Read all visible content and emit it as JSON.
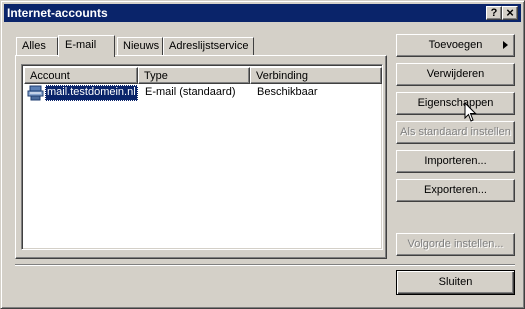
{
  "window": {
    "title": "Internet-accounts",
    "help_button": "?",
    "close_button": "×"
  },
  "tabs": [
    {
      "label": "Alles",
      "active": false
    },
    {
      "label": "E-mail",
      "active": true
    },
    {
      "label": "Nieuws",
      "active": false
    },
    {
      "label": "Adreslijstservice",
      "active": false
    }
  ],
  "list": {
    "columns": [
      "Account",
      "Type",
      "Verbinding"
    ],
    "rows": [
      {
        "account": "mail.testdomein.nl",
        "type": "E-mail (standaard)",
        "connection": "Beschikbaar",
        "selected": true,
        "icon": "mail-server-icon"
      }
    ]
  },
  "buttons": {
    "add": "Toevoegen",
    "remove": "Verwijderen",
    "properties": "Eigenschappen",
    "set_default": "Als standaard instellen",
    "import": "Importeren...",
    "export": "Exporteren...",
    "order": "Volgorde instellen...",
    "close": "Sluiten"
  },
  "colors": {
    "titlebar": "#0a246a",
    "face": "#d4d0c8",
    "selection": "#0a246a"
  }
}
